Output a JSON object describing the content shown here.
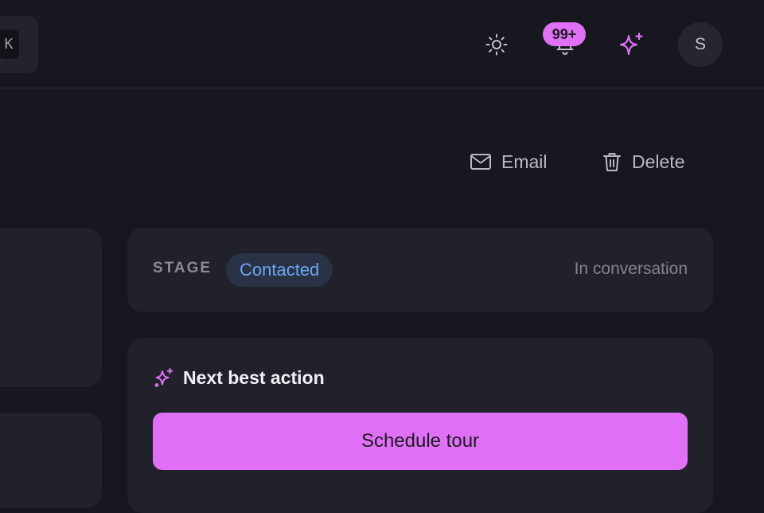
{
  "topbar": {
    "shortcut_key": "K",
    "notifications": {
      "badge": "99+"
    },
    "avatar_initial": "S"
  },
  "actions": {
    "email_label": "Email",
    "delete_label": "Delete"
  },
  "stage": {
    "label": "STAGE",
    "value": "Contacted",
    "status": "In conversation"
  },
  "next_best_action": {
    "title": "Next best action",
    "button_label": "Schedule tour"
  },
  "colors": {
    "accent": "#e070f5",
    "background": "#17171f",
    "card": "#21212b",
    "stage_pill_bg": "#2a3346",
    "stage_pill_text": "#6ba5f2"
  }
}
